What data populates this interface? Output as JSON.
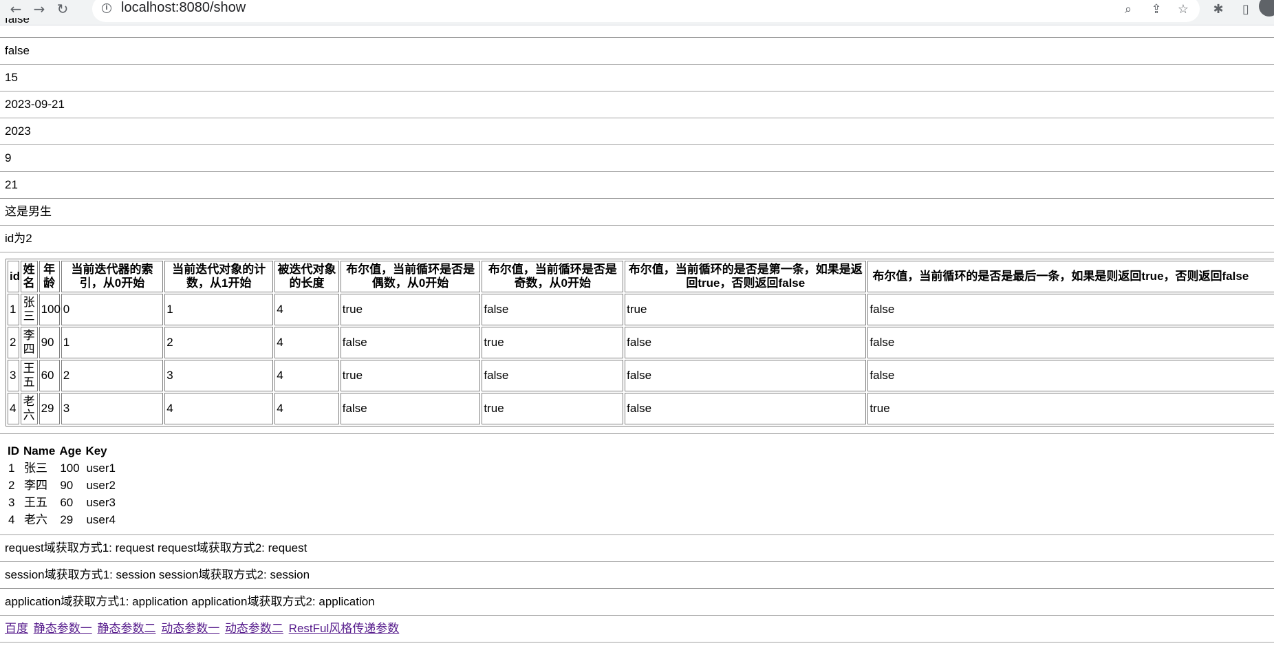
{
  "browser": {
    "url": "localhost:8080/show",
    "back_icon": "←",
    "forward_icon": "→",
    "reload_icon": "↻",
    "info_icon": "i",
    "zoom_icon": "⌕",
    "share_icon": "⇪",
    "star_icon": "☆",
    "extensions_icon": "✱",
    "sidepanel_icon": "▯"
  },
  "lines": {
    "cut_top": "false",
    "l1": "false",
    "l2": "15",
    "l3": "2023-09-21",
    "l4": "2023",
    "l5": "9",
    "l6": "21",
    "l7": "这是男生",
    "l8": "id为2"
  },
  "loop_table": {
    "headers": [
      "id",
      "姓名",
      "年龄",
      "当前迭代器的索引，从0开始",
      "当前迭代对象的计数，从1开始",
      "被迭代对象的长度",
      "布尔值，当前循环是否是偶数，从0开始",
      "布尔值，当前循环是否是奇数，从0开始",
      "布尔值，当前循环的是否是第一条，如果是返回true，否则返回false",
      "布尔值，当前循环的是否是最后一条，如果是则返回true，否则返回false"
    ],
    "rows": [
      [
        "1",
        "张三",
        "100",
        "0",
        "1",
        "4",
        "true",
        "false",
        "true",
        "false"
      ],
      [
        "2",
        "李四",
        "90",
        "1",
        "2",
        "4",
        "false",
        "true",
        "false",
        "false"
      ],
      [
        "3",
        "王五",
        "60",
        "2",
        "3",
        "4",
        "true",
        "false",
        "false",
        "false"
      ],
      [
        "4",
        "老六",
        "29",
        "3",
        "4",
        "4",
        "false",
        "true",
        "false",
        "true"
      ]
    ]
  },
  "map_table": {
    "headers": [
      "ID",
      "Name",
      "Age",
      "Key"
    ],
    "rows": [
      [
        "1",
        "张三",
        "100",
        "user1"
      ],
      [
        "2",
        "李四",
        "90",
        "user2"
      ],
      [
        "3",
        "王五",
        "60",
        "user3"
      ],
      [
        "4",
        "老六",
        "29",
        "user4"
      ]
    ]
  },
  "scopes": {
    "request": "request域获取方式1: request request域获取方式2: request",
    "session": "session域获取方式1: session session域获取方式2: session",
    "application": "application域获取方式1: application application域获取方式2: application"
  },
  "links": [
    "百度",
    "静态参数一",
    "静态参数二",
    "动态参数一",
    "动态参数二",
    "RestFul风格传递参数"
  ]
}
